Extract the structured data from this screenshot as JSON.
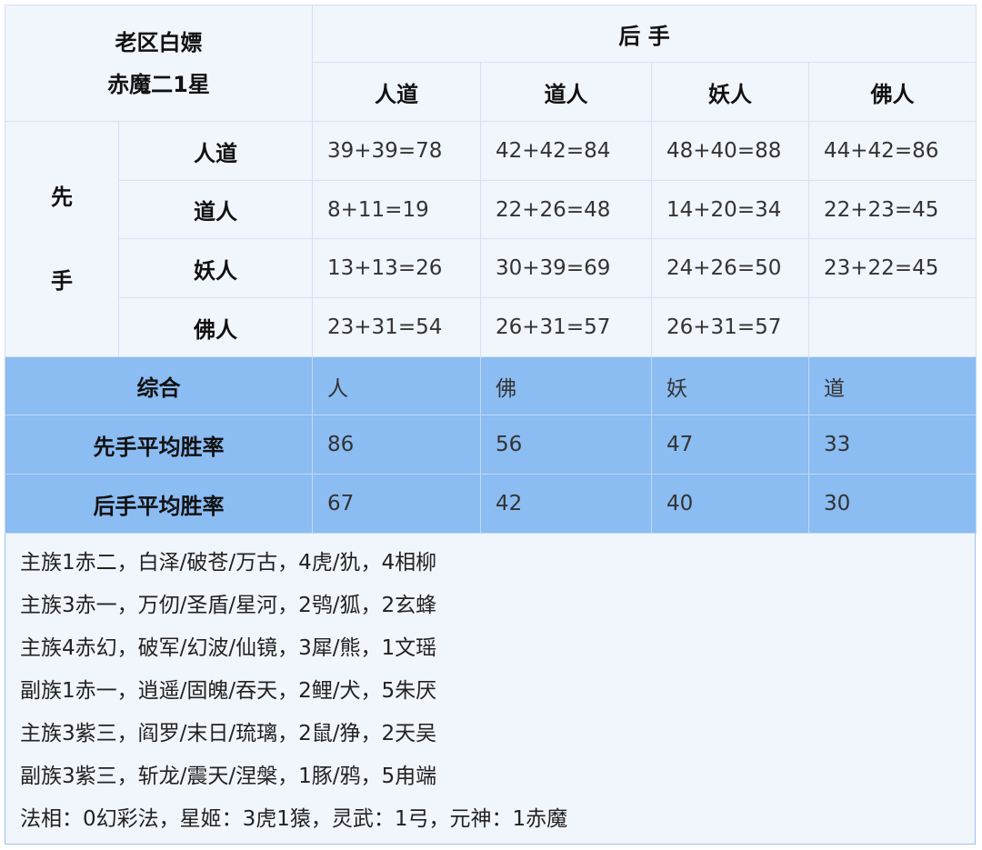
{
  "corner": {
    "line1": "老区白嫖",
    "line2": "赤魔二1星"
  },
  "second_hand": {
    "label": "后 手",
    "columns": [
      "人道",
      "道人",
      "妖人",
      "佛人"
    ]
  },
  "first_hand": {
    "char1": "先",
    "char2": "手"
  },
  "rows": [
    {
      "label": "人道",
      "cells": [
        "39+39=78",
        "42+42=84",
        "48+40=88",
        "44+42=86"
      ]
    },
    {
      "label": "道人",
      "cells": [
        "8+11=19",
        "22+26=48",
        "14+20=34",
        "22+23=45"
      ]
    },
    {
      "label": "妖人",
      "cells": [
        "13+13=26",
        "30+39=69",
        "24+26=50",
        "23+22=45"
      ]
    },
    {
      "label": "佛人",
      "cells": [
        "23+31=54",
        "26+31=57",
        "26+31=57",
        ""
      ]
    }
  ],
  "summary": [
    {
      "label": "综合",
      "cells": [
        "人",
        "佛",
        "妖",
        "道"
      ]
    },
    {
      "label": "先手平均胜率",
      "cells": [
        "86",
        "56",
        "47",
        "33"
      ]
    },
    {
      "label": "后手平均胜率",
      "cells": [
        "67",
        "42",
        "40",
        "30"
      ]
    }
  ],
  "notes": [
    "主族1赤二，白泽/破苍/万古，4虎/犰，4相柳",
    "主族3赤一，万仞/圣盾/星河，2鸮/狐，2玄蜂",
    "主族4赤幻，破军/幻波/仙镜，3犀/熊，1文瑶",
    "副族1赤一，逍遥/固魄/吞天，2鲤/犬，5朱厌",
    "主族3紫三，阎罗/末日/琉璃，2鼠/狰，2天吴",
    "副族3紫三，斩龙/震天/涅槃，1豚/鸦，5甪端",
    "法相：0幻彩法，星姬：3虎1猿，灵武：1弓，元神：1赤魔"
  ],
  "colors": {
    "summary_bg": "#8bbcf2",
    "cell_bg": "#f1f5fc",
    "border": "#9fc1ee"
  }
}
